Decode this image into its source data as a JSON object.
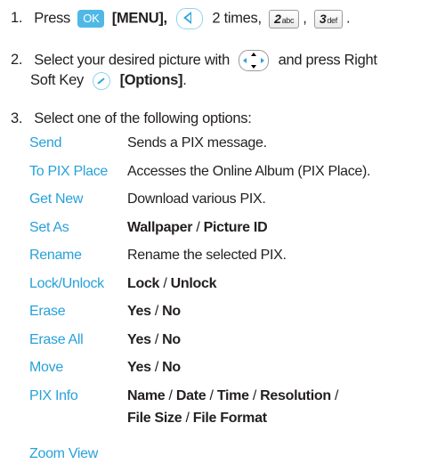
{
  "steps": {
    "s1": {
      "num": "1.",
      "text_a": "Press",
      "ok_key": "OK",
      "menu": "[MENU],",
      "text_b": "2 times,",
      "key2_digit": "2",
      "key2_letters": "abc",
      "comma": ",",
      "key3_digit": "3",
      "key3_letters": "def",
      "period": "."
    },
    "s2": {
      "num": "2.",
      "text_a": "Select your desired picture with",
      "text_b": "and press Right",
      "line2_a": "Soft Key",
      "options": "[Options]",
      "period": "."
    },
    "s3": {
      "num": "3.",
      "text": "Select one of the following options:"
    }
  },
  "options": [
    {
      "name": "Send",
      "desc": "Sends a PIX message."
    },
    {
      "name": "To PIX Place",
      "desc": "Accesses the Online Album (PIX Place)."
    },
    {
      "name": "Get New",
      "desc": "Download various PIX."
    },
    {
      "name": "Set As",
      "desc_a": "Wallpaper",
      "slash": "/",
      "desc_b": "Picture ID"
    },
    {
      "name": "Rename",
      "desc": "Rename the selected PIX."
    },
    {
      "name": "Lock/Unlock",
      "desc_a": "Lock",
      "slash": "/",
      "desc_b": "Unlock"
    },
    {
      "name": "Erase",
      "desc_a": "Yes",
      "slash": "/",
      "desc_b": "No"
    },
    {
      "name": "Erase All",
      "desc_a": "Yes",
      "slash": "/",
      "desc_b": "No"
    },
    {
      "name": "Move",
      "desc_a": "Yes",
      "slash": "/",
      "desc_b": "No"
    },
    {
      "name": "PIX Info",
      "line1_a": "Name",
      "line1_b": "Date",
      "line1_c": "Time",
      "line1_d": "Resolution",
      "line2_a": "File Size",
      "line2_b": "File Format",
      "slash": "/"
    },
    {
      "name": "Zoom View"
    }
  ],
  "colors": {
    "option_name": "#27a1da",
    "body_text": "#231f20",
    "ok_key": "#4fb8e6"
  },
  "icons": {
    "ok": "ok-key-icon",
    "left": "left-nav-key-icon",
    "dpad": "directional-key-icon",
    "softkey": "right-soft-key-icon"
  }
}
